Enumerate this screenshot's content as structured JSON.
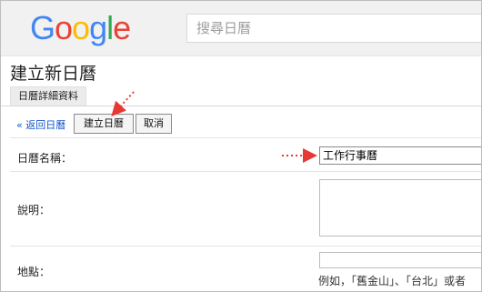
{
  "logo": {
    "letters": [
      {
        "char": "G",
        "color": "#4285F4"
      },
      {
        "char": "o",
        "color": "#EA4335"
      },
      {
        "char": "o",
        "color": "#FBBC05"
      },
      {
        "char": "g",
        "color": "#4285F4"
      },
      {
        "char": "l",
        "color": "#34A853"
      },
      {
        "char": "e",
        "color": "#EA4335"
      }
    ]
  },
  "search": {
    "placeholder": "搜尋日曆"
  },
  "page": {
    "title": "建立新日曆",
    "tab_label": "日曆詳細資料"
  },
  "toolbar": {
    "back_label": "« 返回日曆",
    "create_label": "建立日曆",
    "cancel_label": "取消"
  },
  "form": {
    "name_label": "日曆名稱：",
    "name_value": "工作行事曆",
    "description_label": "說明：",
    "location_label": "地點：",
    "location_hint": "例如，「舊金山」、「台北」或者"
  },
  "annotations": {
    "arrow_color": "#e53935"
  }
}
